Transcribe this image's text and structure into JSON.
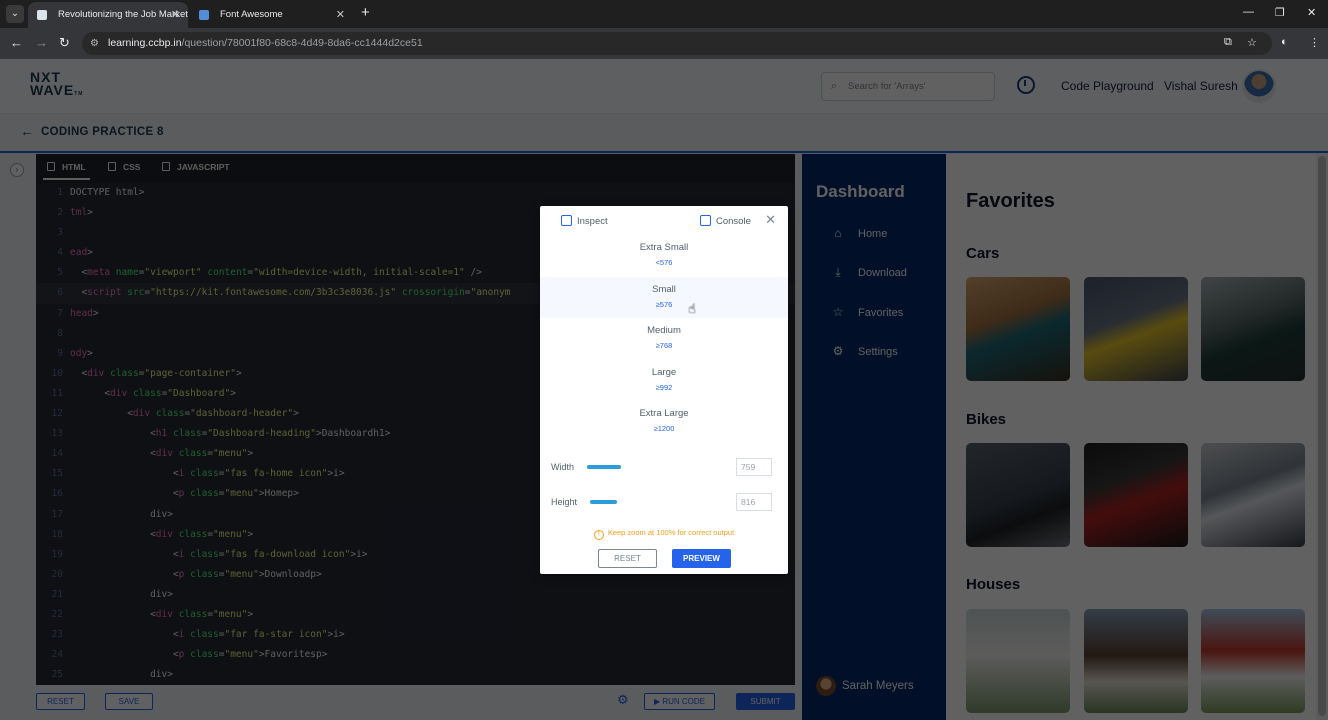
{
  "browser": {
    "tabs": [
      {
        "title": "Revolutionizing the Job Market |",
        "favicon_color": "#dbe3ec",
        "active": true
      },
      {
        "title": "Font Awesome",
        "favicon_color": "#528dd7",
        "active": false
      }
    ],
    "url_host": "learning.ccbp.in",
    "url_path": "/question/78001f80-68c8-4d49-8da6-cc1444d2ce51"
  },
  "header": {
    "logo_line1": "NXT",
    "logo_line2": "WAVE",
    "logo_tm": "TM",
    "search_placeholder": "Search for 'Arrays'",
    "code_playground": "Code Playground",
    "user_name": "Vishal Suresh"
  },
  "subheader": {
    "title": "CODING PRACTICE 8"
  },
  "editor": {
    "tabs": [
      "HTML",
      "CSS",
      "JAVASCRIPT"
    ],
    "lines": [
      {
        "n": "1",
        "html": "DOCTYPE html>"
      },
      {
        "n": "2",
        "html": "<span class=\"tag\">tml</span>>"
      },
      {
        "n": "3",
        "html": ""
      },
      {
        "n": "4",
        "html": "<span class=\"tag\">ead</span>>"
      },
      {
        "n": "5",
        "html": "  <<span class=\"tag\">meta</span> <span class=\"attr\">name</span>=<span class=\"str\">\"viewport\"</span> <span class=\"attr\">content</span>=<span class=\"str\">\"width=device-width, initial-scale=1\"</span> />"
      },
      {
        "n": "6",
        "html": "  <<span class=\"tag\">script</span> <span class=\"attr\">src</span>=<span class=\"str\">\"https://kit.fontawesome.com/3b3c3e8036.js\"</span> <span class=\"attr\">crossorigin</span>=<span class=\"str\">\"anonym</span>"
      },
      {
        "n": "7",
        "html": "<span class=\"tag\">head</span>>"
      },
      {
        "n": "8",
        "html": ""
      },
      {
        "n": "9",
        "html": "<span class=\"tag\">ody</span>>"
      },
      {
        "n": "10",
        "html": "  <<span class=\"tag\">div</span> <span class=\"attr\">class</span>=<span class=\"str\">\"page-container\"</span>>"
      },
      {
        "n": "11",
        "html": "      <<span class=\"tag\">div</span> <span class=\"attr\">class</span>=<span class=\"str\">\"Dashboard\"</span>>"
      },
      {
        "n": "12",
        "html": "          <<span class=\"tag\">div</span> <span class=\"attr\">class</span>=<span class=\"str\">\"dashboard-header\"</span>>"
      },
      {
        "n": "13",
        "html": "              <<span class=\"tag\">h1</span> <span class=\"attr\">class</span>=<span class=\"str\">\"Dashboard-heading\"</span>>Dashboard</<span class=\"tag\">h1</span>>"
      },
      {
        "n": "14",
        "html": "              <<span class=\"tag\">div</span> <span class=\"attr\">class</span>=<span class=\"str\">\"menu\"</span>>"
      },
      {
        "n": "15",
        "html": "                  <<span class=\"tag\">i</span> <span class=\"attr\">class</span>=<span class=\"str\">\"fas fa-home icon\"</span>></<span class=\"tag\">i</span>>"
      },
      {
        "n": "16",
        "html": "                  <<span class=\"tag\">p</span> <span class=\"attr\">class</span>=<span class=\"str\">\"menu\"</span>>Home</<span class=\"tag\">p</span>>"
      },
      {
        "n": "17",
        "html": "              </<span class=\"tag\">div</span>>"
      },
      {
        "n": "18",
        "html": "              <<span class=\"tag\">div</span> <span class=\"attr\">class</span>=<span class=\"str\">\"menu\"</span>>"
      },
      {
        "n": "19",
        "html": "                  <<span class=\"tag\">i</span> <span class=\"attr\">class</span>=<span class=\"str\">\"fas fa-download icon\"</span>></<span class=\"tag\">i</span>>"
      },
      {
        "n": "20",
        "html": "                  <<span class=\"tag\">p</span> <span class=\"attr\">class</span>=<span class=\"str\">\"menu\"</span>>Download</<span class=\"tag\">p</span>>"
      },
      {
        "n": "21",
        "html": "              </<span class=\"tag\">div</span>>"
      },
      {
        "n": "22",
        "html": "              <<span class=\"tag\">div</span> <span class=\"attr\">class</span>=<span class=\"str\">\"menu\"</span>>"
      },
      {
        "n": "23",
        "html": "                  <<span class=\"tag\">i</span> <span class=\"attr\">class</span>=<span class=\"str\">\"far fa-star icon\"</span>></<span class=\"tag\">i</span>>"
      },
      {
        "n": "24",
        "html": "                  <<span class=\"tag\">p</span> <span class=\"attr\">class</span>=<span class=\"str\">\"menu\"</span>>Favorites</<span class=\"tag\">p</span>>"
      },
      {
        "n": "25",
        "html": "              </<span class=\"tag\">div</span>>"
      }
    ]
  },
  "bottombar": {
    "reset": "RESET",
    "save": "SAVE",
    "run_code": "RUN CODE",
    "submit": "SUBMIT"
  },
  "preview": {
    "dashboard_title": "Dashboard",
    "menu": [
      {
        "label": "Home",
        "icon": "home-icon"
      },
      {
        "label": "Download",
        "icon": "download-icon"
      },
      {
        "label": "Favorites",
        "icon": "star-icon"
      },
      {
        "label": "Settings",
        "icon": "gear-icon"
      }
    ],
    "user": "Sarah Meyers",
    "favorites_title": "Favorites",
    "sections": [
      {
        "title": "Cars",
        "images": [
          "teal sports car",
          "yellow sports car",
          "dark green sports car"
        ]
      },
      {
        "title": "Bikes",
        "images": [
          "black motorcycle",
          "red motorcycle",
          "white sport motorcycle"
        ]
      },
      {
        "title": "Houses",
        "images": [
          "white house",
          "brown house",
          "red and white house"
        ]
      }
    ]
  },
  "modal": {
    "inspect": "Inspect",
    "console": "Console",
    "breakpoints": [
      {
        "name": "Extra Small",
        "value": "<576"
      },
      {
        "name": "Small",
        "value": "≥576"
      },
      {
        "name": "Medium",
        "value": "≥768"
      },
      {
        "name": "Large",
        "value": "≥992"
      },
      {
        "name": "Extra Large",
        "value": "≥1200"
      }
    ],
    "selected_breakpoint": "Small",
    "width_label": "Width",
    "width_value": "759",
    "height_label": "Height",
    "height_value": "816",
    "zoom_note": "Keep zoom at 100% for correct output",
    "reset": "RESET",
    "preview": "PREVIEW"
  }
}
